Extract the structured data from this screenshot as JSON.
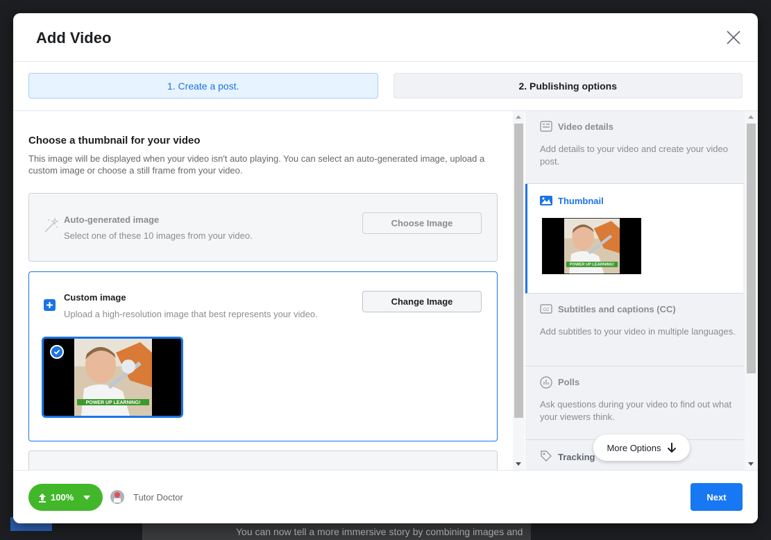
{
  "background": {
    "strip_text": "You can now tell a more immersive story by combining images and"
  },
  "dialog": {
    "title": "Add Video",
    "steps": [
      {
        "label": "1. Create a post.",
        "active": true
      },
      {
        "label": "2. Publishing options",
        "active": false
      }
    ]
  },
  "thumbnail_section": {
    "title": "Choose a thumbnail for your video",
    "description": "This image will be displayed when your video isn't auto playing. You can select an auto-generated image, upload a custom image or choose a still frame from your video.",
    "options": {
      "auto": {
        "title": "Auto-generated image",
        "subtitle": "Select one of these 10 images from your video.",
        "button": "Choose Image",
        "icon": "magic-wand-icon"
      },
      "custom": {
        "title": "Custom image",
        "subtitle": "Upload a high-resolution image that best represents your video.",
        "button": "Change Image",
        "icon": "add-image-icon",
        "thumb_caption": "POWER UP LEARNING!"
      }
    }
  },
  "sidebar": {
    "items": [
      {
        "title": "Video details",
        "description": "Add details to your video and create your video post.",
        "icon": "details-icon"
      },
      {
        "title": "Thumbnail",
        "icon": "image-icon",
        "active": true,
        "thumb_caption": "POWER UP LEARNING!"
      },
      {
        "title": "Subtitles and captions (CC)",
        "description": "Add subtitles to your video in multiple languages.",
        "icon": "cc-icon"
      },
      {
        "title": "Polls",
        "description": "Ask questions during your video to find out what your viewers think.",
        "icon": "poll-icon"
      },
      {
        "title": "Tracking",
        "icon": "tag-icon"
      }
    ],
    "more_options": "More Options"
  },
  "footer": {
    "upload_progress": "100%",
    "page_name": "Tutor Doctor",
    "next": "Next"
  },
  "colors": {
    "accent": "#1b74e4",
    "upload_green": "#42b72a",
    "next_blue": "#1877f2"
  }
}
